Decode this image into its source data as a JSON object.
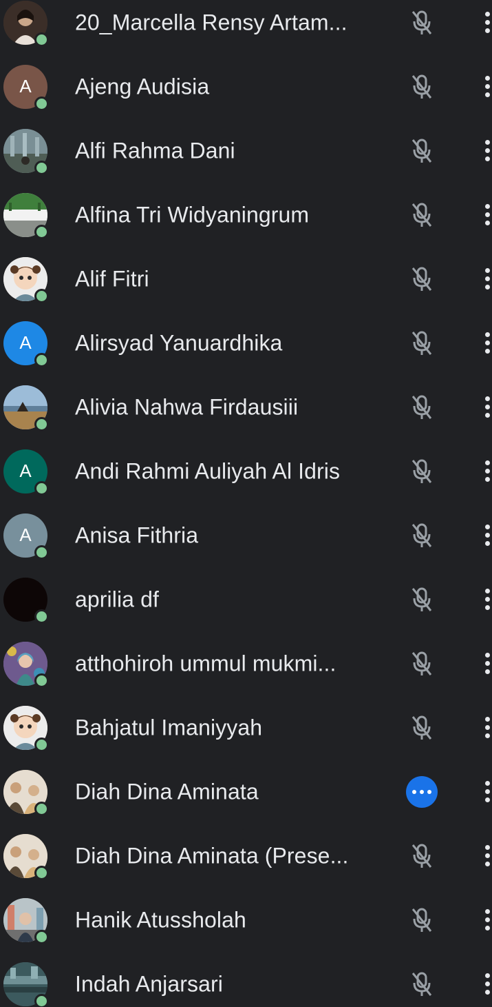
{
  "colors": {
    "background": "#202124",
    "text": "#e8eaed",
    "presence": "#81c995",
    "speaking": "#1a73e8",
    "mic_muted": "#9aa0a6"
  },
  "participants": [
    {
      "name": "20_Marcella Rensy Artam...",
      "avatar_type": "photo",
      "avatar_color": "#4a3b34",
      "mic": "muted"
    },
    {
      "name": "Ajeng Audisia",
      "avatar_type": "initial",
      "initial": "A",
      "avatar_color": "#795548",
      "mic": "muted"
    },
    {
      "name": "Alfi Rahma Dani",
      "avatar_type": "photo",
      "avatar_color": "#6b7f86",
      "mic": "muted"
    },
    {
      "name": "Alfina Tri Widyaningrum",
      "avatar_type": "photo",
      "avatar_color": "#4e8a4a",
      "mic": "muted"
    },
    {
      "name": "Alif Fitri",
      "avatar_type": "photo",
      "avatar_color": "#d9c7b0",
      "mic": "muted"
    },
    {
      "name": "Alirsyad Yanuardhika",
      "avatar_type": "initial",
      "initial": "A",
      "avatar_color": "#1e88e5",
      "mic": "muted"
    },
    {
      "name": "Alivia Nahwa Firdausiii",
      "avatar_type": "photo",
      "avatar_color": "#7fa3c4",
      "mic": "muted"
    },
    {
      "name": "Andi Rahmi Auliyah Al Idris",
      "avatar_type": "initial",
      "initial": "A",
      "avatar_color": "#00695c",
      "mic": "muted"
    },
    {
      "name": "Anisa Fithria",
      "avatar_type": "initial",
      "initial": "A",
      "avatar_color": "#78909c",
      "mic": "muted"
    },
    {
      "name": "aprilia df",
      "avatar_type": "photo",
      "avatar_color": "#0d0606",
      "mic": "muted"
    },
    {
      "name": "atthohiroh ummul mukmi...",
      "avatar_type": "photo",
      "avatar_color": "#8a6fa8",
      "mic": "muted"
    },
    {
      "name": "Bahjatul Imaniyyah",
      "avatar_type": "photo",
      "avatar_color": "#d9c7b0",
      "mic": "muted"
    },
    {
      "name": "Diah Dina Aminata",
      "avatar_type": "photo",
      "avatar_color": "#a88e6a",
      "mic": "speaking"
    },
    {
      "name": "Diah Dina Aminata (Prese...",
      "avatar_type": "photo",
      "avatar_color": "#a88e6a",
      "mic": "muted"
    },
    {
      "name": "Hanik Atussholah",
      "avatar_type": "photo",
      "avatar_color": "#8c8c8c",
      "mic": "muted"
    },
    {
      "name": "Indah Anjarsari",
      "avatar_type": "photo",
      "avatar_color": "#4a6a6e",
      "mic": "muted"
    }
  ],
  "icons": {
    "mic_muted": "mic-off-icon",
    "speaking": "audio-level-icon",
    "more": "more-vert-icon",
    "presence": "presence-dot-icon"
  }
}
